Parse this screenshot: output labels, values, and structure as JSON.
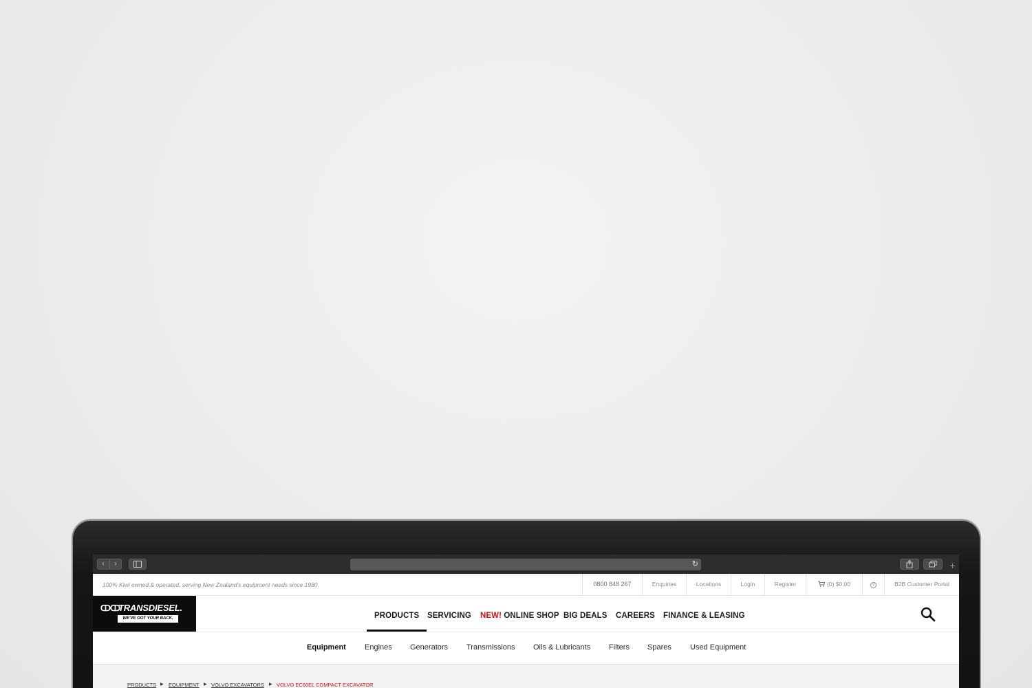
{
  "top_strip": {
    "tagline": "100% Kiwi owned & operated, serving New Zealand's equipment needs since 1980.",
    "links": [
      "0800 848 267",
      "Enquiries",
      "Locations",
      "Login",
      "Register",
      "(0) $0.00",
      "?",
      "B2B Customer Portal"
    ]
  },
  "logo": {
    "mark": "ↀↀ",
    "name": "TRANSDIESEL.",
    "tagline": "WE'VE GOT YOUR BACK."
  },
  "main_nav": [
    {
      "label": "PRODUCTS"
    },
    {
      "label": "SERVICING"
    },
    {
      "label": "ONLINE SHOP",
      "prefix": "NEW!"
    },
    {
      "label": "BIG DEALS"
    },
    {
      "label": "CAREERS"
    },
    {
      "label": "FINANCE & LEASING"
    }
  ],
  "sub_nav": [
    "Equipment",
    "Engines",
    "Generators",
    "Transmissions",
    "Oils & Lubricants",
    "Filters",
    "Spares",
    "Used Equipment"
  ],
  "breadcrumb": [
    "PRODUCTS",
    "EQUIPMENT",
    "VOLVO EXCAVATORS",
    "VOLVO EC60EL COMPACT EXCAVATOR"
  ],
  "browser": {
    "back": "‹",
    "forward": "›",
    "reload": "↻",
    "new_tab": "+"
  },
  "colors": {
    "accent": "#d0121b",
    "logo_bg": "#0c0c0c",
    "toolbar": "#2c2c2e"
  },
  "icons": {
    "cart": "cart-icon",
    "help": "help-icon",
    "search": "search-icon"
  }
}
